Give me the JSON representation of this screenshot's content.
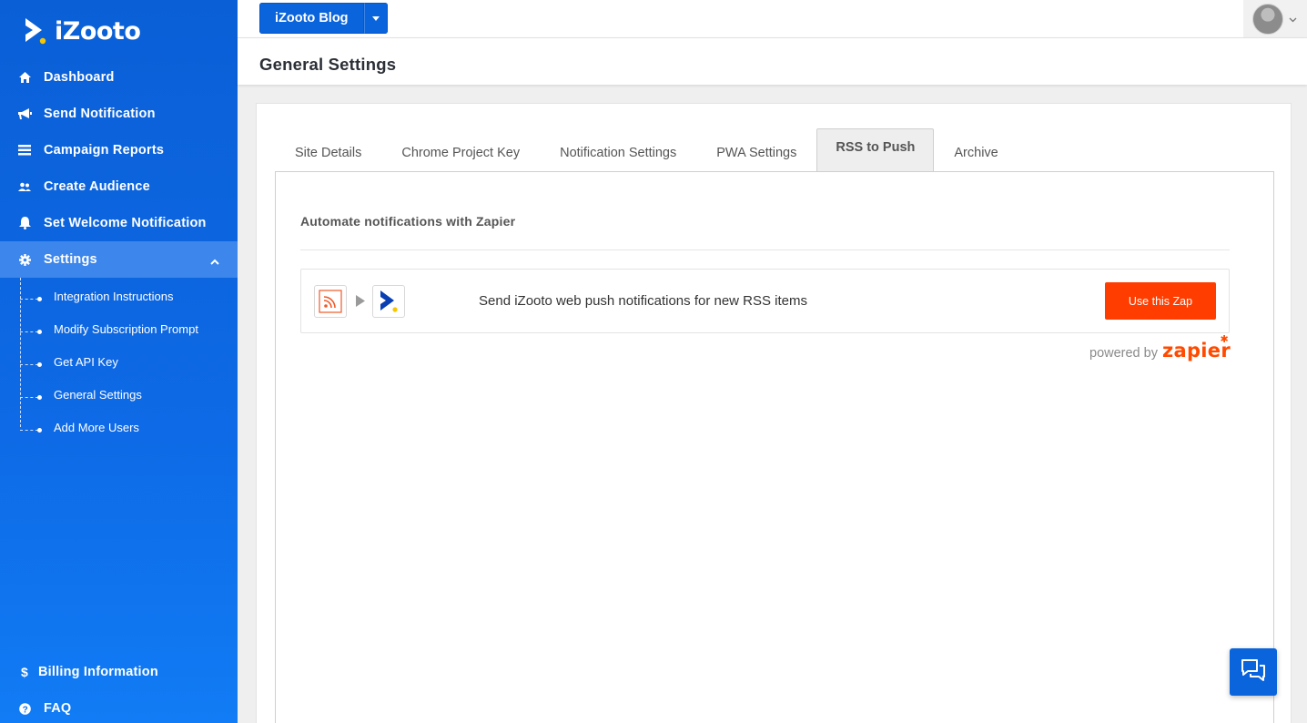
{
  "brand": {
    "name": "iZooto"
  },
  "sidebar": {
    "items": [
      {
        "label": "Dashboard",
        "icon": "home-icon"
      },
      {
        "label": "Send Notification",
        "icon": "megaphone-icon"
      },
      {
        "label": "Campaign Reports",
        "icon": "report-icon"
      },
      {
        "label": "Create Audience",
        "icon": "users-icon"
      },
      {
        "label": "Set Welcome Notification",
        "icon": "bell-icon"
      },
      {
        "label": "Settings",
        "icon": "gear-icon"
      }
    ],
    "settings_sub": [
      {
        "label": "Integration Instructions"
      },
      {
        "label": "Modify Subscription Prompt"
      },
      {
        "label": "Get API Key"
      },
      {
        "label": "General Settings"
      },
      {
        "label": "Add More Users"
      }
    ],
    "bottom": [
      {
        "label": "Billing Information",
        "icon": "dollar-icon"
      },
      {
        "label": "FAQ",
        "icon": "question-icon"
      }
    ]
  },
  "topbar": {
    "site_label": "iZooto Blog"
  },
  "page": {
    "title": "General Settings"
  },
  "tabs": [
    {
      "label": "Site Details"
    },
    {
      "label": "Chrome Project Key"
    },
    {
      "label": "Notification Settings"
    },
    {
      "label": "PWA Settings"
    },
    {
      "label": "RSS to Push",
      "active": true
    },
    {
      "label": "Archive"
    }
  ],
  "panel": {
    "title": "Automate notifications with Zapier",
    "zap": {
      "description": "Send iZooto web push notifications for new RSS items",
      "button_label": "Use this Zap"
    },
    "powered_by": "powered by",
    "powered_brand": "zapier"
  },
  "colors": {
    "sidebar": "#0a5fd6",
    "accent": "#0a64dc",
    "zap_button": "#ff3d00",
    "zapier_brand": "#ff4a00"
  }
}
